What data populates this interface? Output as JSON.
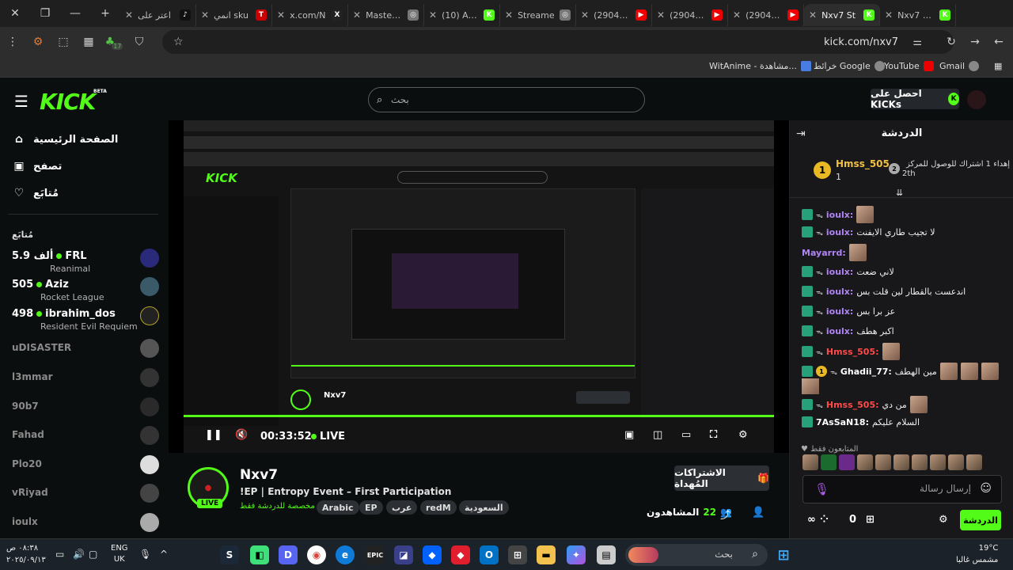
{
  "browser": {
    "tabs": [
      {
        "label": "اعتر على",
        "fav_color": "#111",
        "fav_glyph": "♪"
      },
      {
        "label": "انمي sku",
        "fav_color": "#c00",
        "fav_glyph": "T"
      },
      {
        "label": "x.com/N",
        "fav_color": "#222",
        "fav_glyph": "X"
      },
      {
        "label": "Masterm",
        "fav_color": "#777",
        "fav_glyph": "◎"
      },
      {
        "label": "(10) Alert",
        "fav_color": "#53fc18",
        "fav_glyph": "K"
      },
      {
        "label": "Streame",
        "fav_color": "#777",
        "fav_glyph": "◎"
      },
      {
        "label": "(2904) A",
        "fav_color": "#e00",
        "fav_glyph": "▶"
      },
      {
        "label": "(2904) S",
        "fav_color": "#e00",
        "fav_glyph": "▶"
      },
      {
        "label": "(2904) S",
        "fav_color": "#e00",
        "fav_glyph": "▶"
      },
      {
        "label": "Nxv7 St",
        "fav_color": "#53fc18",
        "fav_glyph": "K"
      },
      {
        "label": "Nxv7 Str",
        "fav_color": "#53fc18",
        "fav_glyph": "K"
      }
    ],
    "url": "kick.com/nxv7",
    "bookmarks": {
      "gmail": "Gmail",
      "youtube": "YouTube",
      "maps": "خرائط Google",
      "witanime": "WitAnime - مشاهدة..."
    },
    "extension_badge": "17"
  },
  "kick": {
    "logo": "KICK",
    "beta": "BETA",
    "search_placeholder": "بحث",
    "get_kicks": "احصل على KICKs",
    "nav": {
      "home": "الصفحة الرئيسية",
      "browse": "تصفح",
      "following": "مُتابَع"
    },
    "following_header": "مُتابَع",
    "live_channels": [
      {
        "name": "FRL",
        "viewers": "5.9 ألف",
        "category": "Reanimal"
      },
      {
        "name": "Aziz",
        "viewers": "505",
        "category": "Rocket League"
      },
      {
        "name": "ibrahim_dos",
        "viewers": "498",
        "category": "Resident Evil Requiem"
      }
    ],
    "offline_channels": [
      "uDISASTER",
      "l3mmar",
      "90b7",
      "Fahad",
      "Plo20",
      "vRiyad",
      "ioulx"
    ]
  },
  "player": {
    "time": "00:33:52",
    "live": "LIVE"
  },
  "stream": {
    "channel": "Nxv7",
    "title": "!EP | Entropy Event – First Participation",
    "sub_only": "مخصصة للدردشة فقط",
    "live_badge": "LIVE",
    "tags": [
      "Arabic",
      "EP",
      "عرب",
      "redM",
      "السعودية"
    ],
    "gift_button": "الاشتراكات المُهداة",
    "viewers_label": "المشاهدون",
    "viewers": "22"
  },
  "chat": {
    "title": "الدردشة",
    "leader1": {
      "name": "Hmss_505",
      "count": "1",
      "rank": "1"
    },
    "leader2": {
      "text": "إهداء 1 اشتراك للوصول للمركز",
      "rank_text": "2th",
      "rank": "2"
    },
    "messages": [
      {
        "user": "ioulx:",
        "color": "#b084f5",
        "text": ""
      },
      {
        "user": "ioulx:",
        "color": "#b084f5",
        "text": "لا تجيب طاري الايفنت"
      },
      {
        "user": "Mayarrd:",
        "color": "#b084f5",
        "text": ""
      },
      {
        "user": "ioulx:",
        "color": "#b084f5",
        "text": "لاني ضعت"
      },
      {
        "user": "ioulx:",
        "color": "#b084f5",
        "text": "اندعست بالقطار لين قلت بس"
      },
      {
        "user": "ioulx:",
        "color": "#b084f5",
        "text": "عز برا بس"
      },
      {
        "user": "ioulx:",
        "color": "#b084f5",
        "text": "اكبر هطف"
      },
      {
        "user": "Hmss_505:",
        "color": "#ff4a4a",
        "text": ""
      },
      {
        "user": "Ghadii_77:",
        "color": "#ffffff",
        "text": "مين الهطف"
      },
      {
        "user": "Hmss_505:",
        "color": "#ff4a4a",
        "text": "من دي"
      },
      {
        "user": "7AsSaN18:",
        "color": "#ffffff",
        "text": "السلام عليكم"
      }
    ],
    "gifters_label": "المتابعون فقط",
    "input_placeholder": "إرسال رسالة",
    "send_button": "الدردشة",
    "points": "0"
  },
  "taskbar": {
    "time": "٠٨:٣٨ ص",
    "date": "٢٠٢٥/٠٩/١٣",
    "lang1": "ENG",
    "lang2": "UK",
    "search_placeholder": "بحث",
    "weather_temp": "19°C",
    "weather_desc": "مشمس غالبا"
  }
}
